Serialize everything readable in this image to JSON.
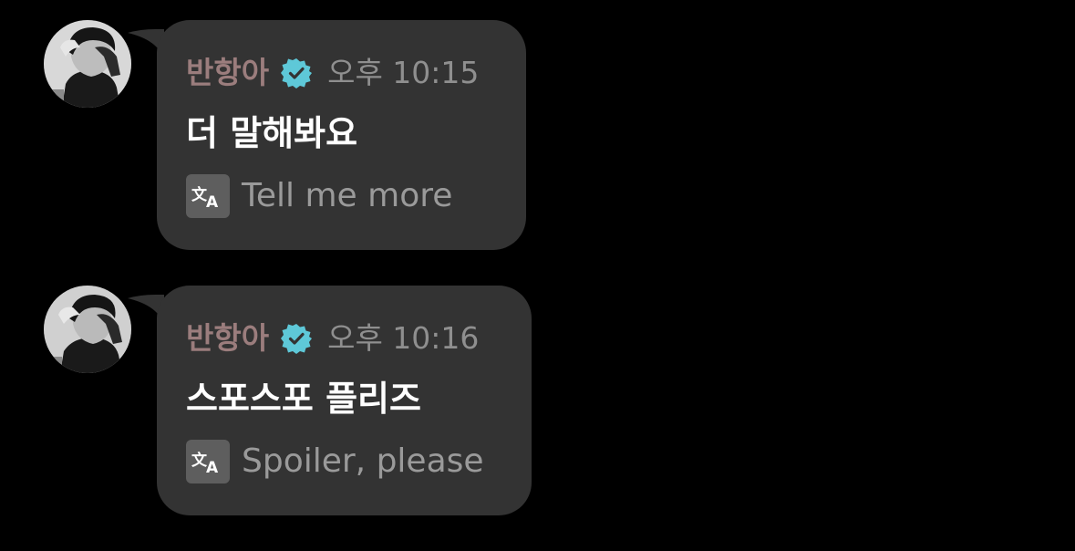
{
  "colors": {
    "background": "#000000",
    "bubble": "#333333",
    "sender_name": "#9b7d7d",
    "verified_badge": "#5ec8d8",
    "timestamp": "#8f8f8f",
    "message_text": "#ffffff",
    "translation_text": "#9a9a9a"
  },
  "messages": [
    {
      "sender": "반항아",
      "verified": true,
      "verified_icon": "verified-badge-icon",
      "time": "오후 10:15",
      "text": "더 말해봐요",
      "translate_icon": "translate-icon",
      "translation": "Tell me more"
    },
    {
      "sender": "반항아",
      "verified": true,
      "verified_icon": "verified-badge-icon",
      "time": "오후 10:16",
      "text": "스포스포 플리즈",
      "translate_icon": "translate-icon",
      "translation": "Spoiler, please"
    }
  ]
}
